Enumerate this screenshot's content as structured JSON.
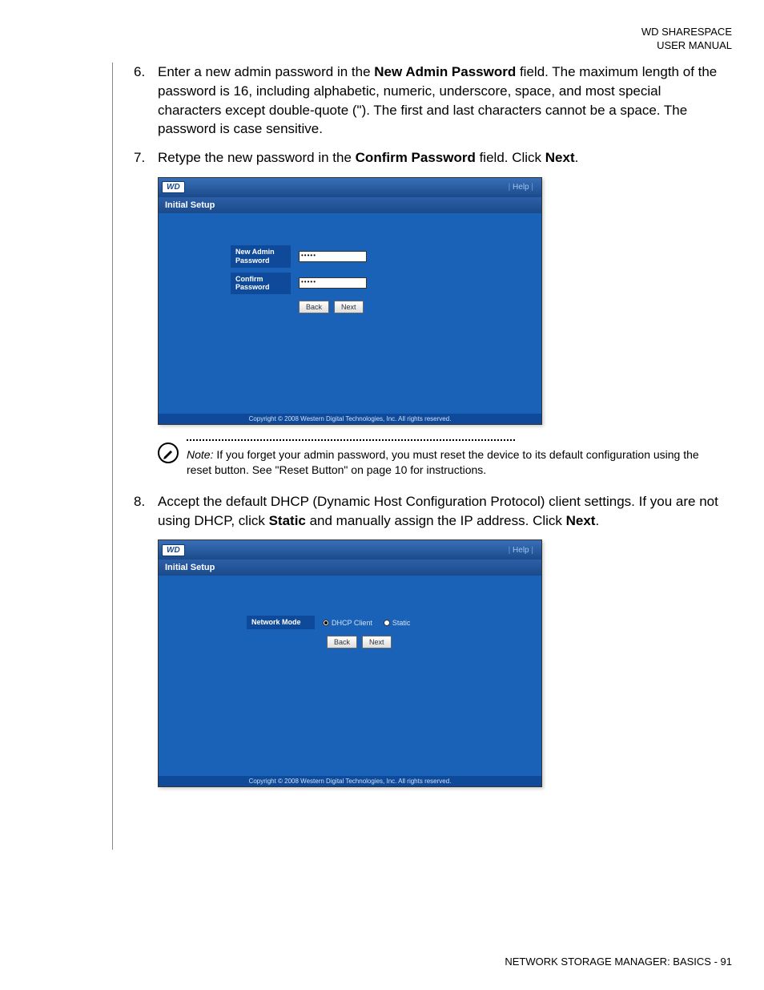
{
  "header": {
    "line1": "WD SHARESPACE",
    "line2": "USER MANUAL"
  },
  "steps": {
    "s6": {
      "num": "6.",
      "t1": "Enter a new admin password in the ",
      "b1": "New Admin Password",
      "t2": " field. The maximum length of the password is 16, including alphabetic, numeric, underscore, space, and most special characters except double-quote (\"). The first and last characters cannot be a space. The password is case sensitive."
    },
    "s7": {
      "num": "7.",
      "t1": "Retype the new password in the ",
      "b1": "Confirm Password",
      "t2": " field. Click ",
      "b2": "Next",
      "t3": "."
    },
    "s8": {
      "num": "8.",
      "t1": "Accept the default DHCP (Dynamic Host Configuration Protocol) client settings. If you are not using DHCP, click ",
      "b1": "Static",
      "t2": " and manually assign the IP address. Click ",
      "b2": "Next",
      "t3": "."
    }
  },
  "shot1": {
    "logo": "WD",
    "help": "Help",
    "title": "Initial Setup",
    "label1": "New Admin Password",
    "label2": "Confirm Password",
    "value1": "•••••",
    "value2": "•••••",
    "back": "Back",
    "next": "Next",
    "copyright": "Copyright © 2008 Western Digital Technologies, Inc. All rights reserved."
  },
  "shot2": {
    "logo": "WD",
    "help": "Help",
    "title": "Initial Setup",
    "label1": "Network Mode",
    "radio1": "DHCP Client",
    "radio2": "Static",
    "back": "Back",
    "next": "Next",
    "copyright": "Copyright © 2008 Western Digital Technologies, Inc. All rights reserved."
  },
  "note": {
    "prefix": "Note:",
    "text": " If you forget your admin password, you must reset the device to its default configuration using the reset button. See \"Reset Button\" on page 10 for instructions."
  },
  "footer": "NETWORK STORAGE MANAGER: BASICS - 91"
}
